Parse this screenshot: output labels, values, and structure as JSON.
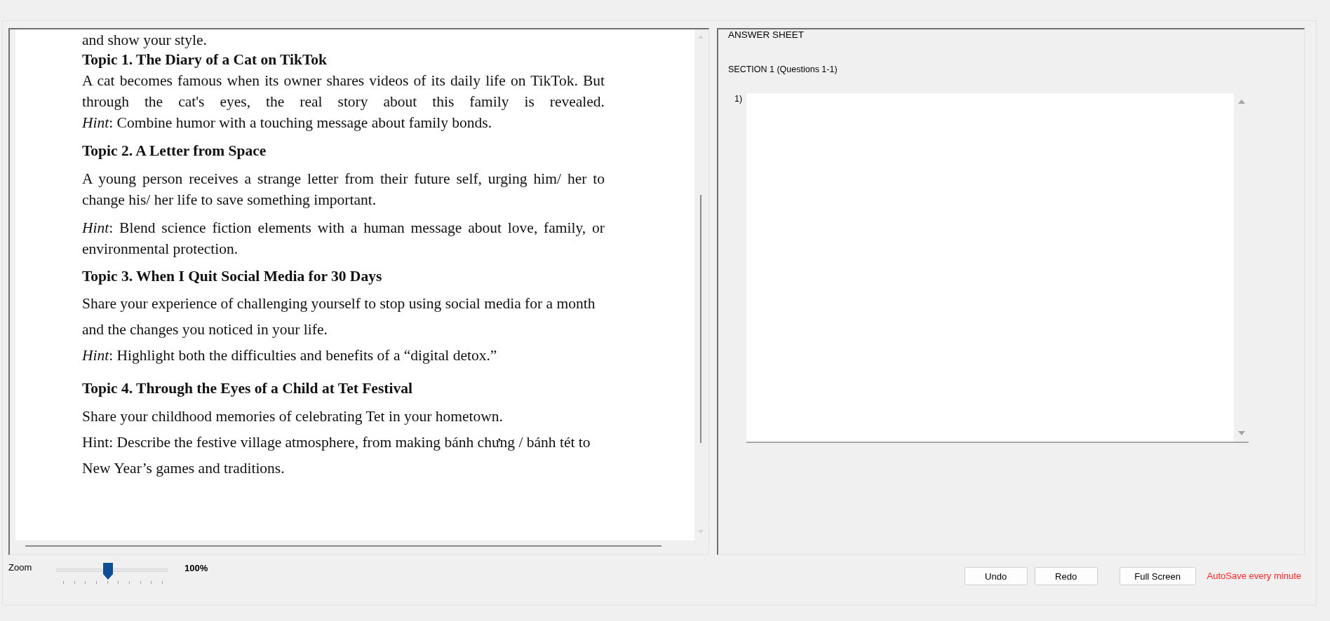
{
  "document": {
    "cut_line": "and show your style.",
    "topics": [
      {
        "heading": "Topic 1. The Diary of a Cat on TikTok",
        "paragraphs": [
          "A cat becomes famous when its owner shares videos of its daily life on TikTok. But through the cat's eyes, the real story about this family is revealed.",
          "*Hint*: Combine humor with a touching message about family bonds."
        ]
      },
      {
        "heading": "Topic 2. A Letter from Space",
        "paragraphs": [
          "A young person receives a strange letter from their future self, urging him/ her to change his/ her life to save something important.",
          "*Hint*: Blend science fiction elements with a human message about love, family, or environmental protection."
        ]
      },
      {
        "heading": "Topic 3. When I Quit Social Media for 30 Days",
        "paragraphs": [
          "Share your experience of challenging yourself to stop using social media for a month and the changes you noticed in your life.",
          "*Hint*: Highlight both the difficulties and benefits of a “digital detox.”"
        ]
      },
      {
        "heading": "Topic 4. Through the Eyes of a Child at Tet Festival",
        "paragraphs": [
          "Share your childhood memories of celebrating Tet in your hometown.",
          "Hint: Describe the festive village atmosphere, from making bánh chưng / bánh tét to New Year’s games and traditions."
        ]
      }
    ]
  },
  "answer_sheet": {
    "title": "ANSWER SHEET",
    "sections": [
      {
        "title": "SECTION 1 (Questions 1-1)",
        "questions": [
          {
            "number": "1)"
          }
        ]
      }
    ]
  },
  "zoom": {
    "label": "Zoom",
    "level": 0.45,
    "reading": "100%"
  },
  "buttons": [
    "Undo",
    "Redo",
    "Full Screen"
  ],
  "autosave_note": "AutoSave every minute"
}
